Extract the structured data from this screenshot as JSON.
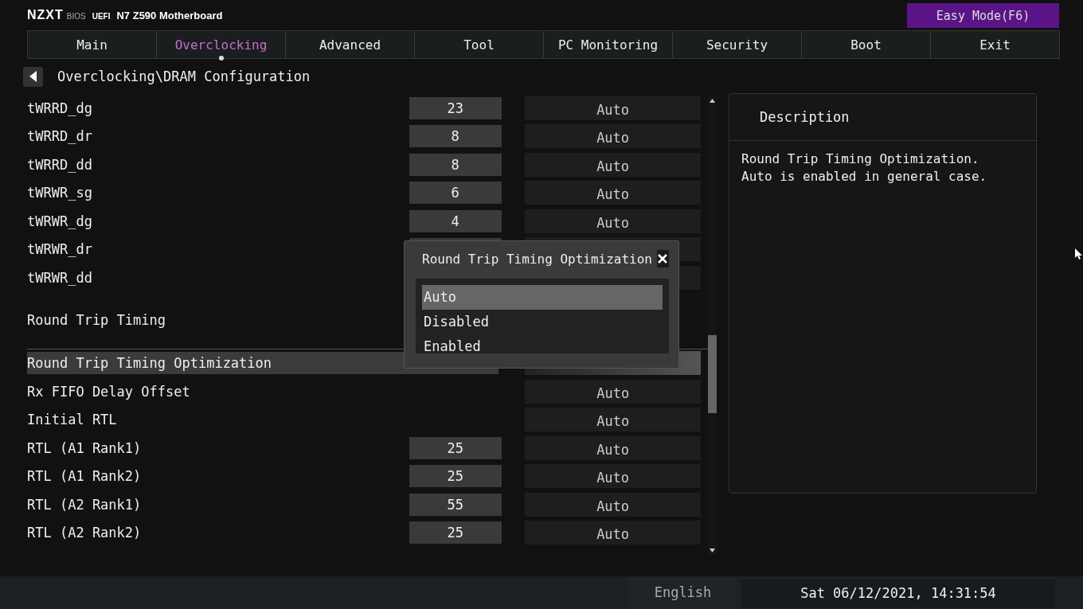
{
  "header": {
    "brand": "NZXT",
    "brand_suffix": "BIOS",
    "firmware": "UEFI",
    "board": "N7 Z590 Motherboard",
    "mode_button": "Easy Mode(F6)"
  },
  "tabs": [
    {
      "label": "Main",
      "selected": false
    },
    {
      "label": "Overclocking",
      "selected": true
    },
    {
      "label": "Advanced",
      "selected": false
    },
    {
      "label": "Tool",
      "selected": false
    },
    {
      "label": "PC Monitoring",
      "selected": false
    },
    {
      "label": "Security",
      "selected": false
    },
    {
      "label": "Boot",
      "selected": false
    },
    {
      "label": "Exit",
      "selected": false
    }
  ],
  "breadcrumb": "Overclocking\\DRAM Configuration",
  "rows": [
    {
      "kind": "setting",
      "label": "tWRRD_dg",
      "value": "23",
      "option": "Auto",
      "selected": false
    },
    {
      "kind": "setting",
      "label": "tWRRD_dr",
      "value": "8",
      "option": "Auto",
      "selected": false
    },
    {
      "kind": "setting",
      "label": "tWRRD_dd",
      "value": "8",
      "option": "Auto",
      "selected": false
    },
    {
      "kind": "setting",
      "label": "tWRWR_sg",
      "value": "6",
      "option": "Auto",
      "selected": false
    },
    {
      "kind": "setting",
      "label": "tWRWR_dg",
      "value": "4",
      "option": "Auto",
      "selected": false
    },
    {
      "kind": "covered",
      "label": "tWRWR_dr",
      "selected": false
    },
    {
      "kind": "option_covered",
      "label": "tWRWR_dd",
      "selected": false
    },
    {
      "kind": "heading",
      "label": "Round Trip Timing"
    },
    {
      "kind": "setting",
      "label": "Round Trip Timing Optimization",
      "selected": true
    },
    {
      "kind": "setting",
      "label": "Rx FIFO Delay Offset",
      "option": "Auto",
      "selected": false
    },
    {
      "kind": "setting",
      "label": "Initial RTL",
      "option": "Auto",
      "selected": false
    },
    {
      "kind": "setting",
      "label": "RTL (A1 Rank1)",
      "value": "25",
      "option": "Auto",
      "selected": false
    },
    {
      "kind": "setting",
      "label": "RTL (A1 Rank2)",
      "value": "25",
      "option": "Auto",
      "selected": false
    },
    {
      "kind": "setting",
      "label": "RTL (A2 Rank1)",
      "value": "55",
      "option": "Auto",
      "selected": false
    },
    {
      "kind": "setting",
      "label": "RTL (A2 Rank2)",
      "value": "25",
      "option": "Auto",
      "selected": false
    }
  ],
  "description": {
    "title": "Description",
    "text": "Round Trip Timing Optimization.\nAuto is enabled in general case."
  },
  "dialog": {
    "title": "Round Trip Timing Optimization",
    "options": [
      {
        "label": "Auto",
        "selected": true
      },
      {
        "label": "Disabled",
        "selected": false
      },
      {
        "label": "Enabled",
        "selected": false
      }
    ]
  },
  "status_bar": {
    "language": "English",
    "datetime": "Sat 06/12/2021, 14:31:54"
  }
}
